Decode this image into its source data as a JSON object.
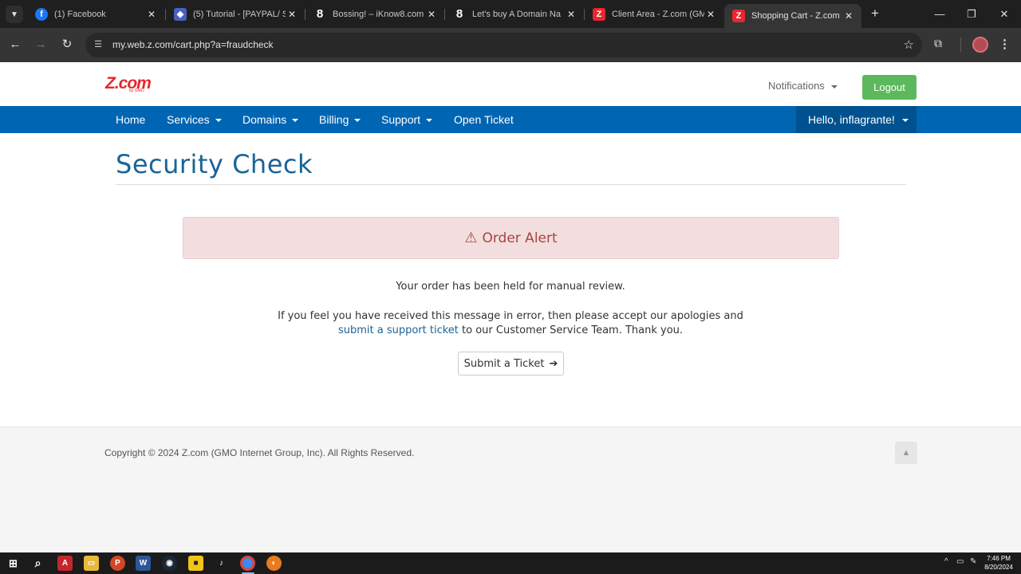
{
  "browser": {
    "tabs": [
      {
        "title": "(1) Facebook",
        "favicon": "facebook-icon",
        "color": "#1877f2"
      },
      {
        "title": "(5) Tutorial - [PAYPAL/ S",
        "favicon": "shield-icon",
        "color": "#6a5acd"
      },
      {
        "title": "Bossing! – iKnow8.com",
        "favicon": "eight-icon",
        "color": "#1f1f1f"
      },
      {
        "title": "Let's buy A Domain Na",
        "favicon": "eight-icon",
        "color": "#1f1f1f"
      },
      {
        "title": "Client Area - Z.com (GM",
        "favicon": "zcom-icon",
        "color": "#e8262e"
      },
      {
        "title": "Shopping Cart - Z.com",
        "favicon": "zcom-icon",
        "color": "#e8262e"
      }
    ],
    "url": "my.web.z.com/cart.php?a=fraudcheck"
  },
  "header": {
    "logo_text": "Z.com",
    "logo_sub": "by GMO",
    "notifications_label": "Notifications",
    "logout_label": "Logout"
  },
  "nav": {
    "items": [
      {
        "label": "Home",
        "dropdown": false
      },
      {
        "label": "Services",
        "dropdown": true
      },
      {
        "label": "Domains",
        "dropdown": true
      },
      {
        "label": "Billing",
        "dropdown": true
      },
      {
        "label": "Support",
        "dropdown": true
      },
      {
        "label": "Open Ticket",
        "dropdown": false
      }
    ],
    "user_label": "Hello, inflagrante!"
  },
  "content": {
    "title": "Security Check",
    "alert_title": "Order Alert",
    "message1": "Your order has been held for manual review.",
    "message2_pre": "If you feel you have received this message in error, then please accept our apologies and",
    "message2_link": "submit a support ticket",
    "message2_post": "to our Customer Service Team. Thank you.",
    "button_label": "Submit a Ticket"
  },
  "footer": {
    "copyright": "Copyright © 2024 Z.com (GMO Internet Group, Inc). All Rights Reserved."
  },
  "taskbar": {
    "time": "7:46 PM",
    "date": "8/20/2024"
  },
  "colors": {
    "brand_red": "#e8262e",
    "nav_blue": "#0065b3",
    "title_blue": "#1a6496",
    "alert_bg": "#f2dede",
    "alert_text": "#a94442",
    "logout_green": "#5cb85c"
  }
}
